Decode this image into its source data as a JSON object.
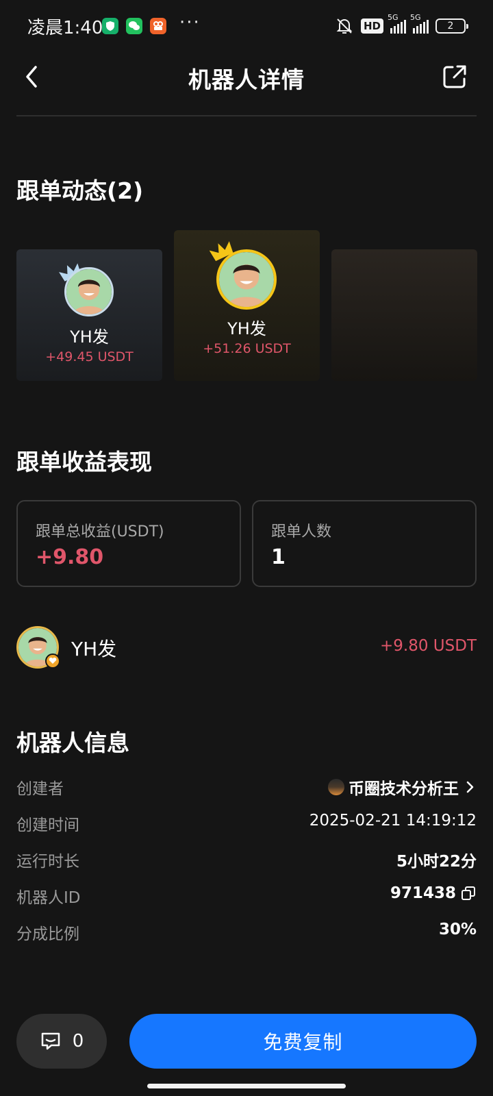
{
  "status_bar": {
    "time": "凌晨1:40",
    "dots": "···",
    "hd": "HD",
    "sim1": "5G",
    "sim2": "5G",
    "battery": "2"
  },
  "nav": {
    "title": "机器人详情"
  },
  "follow_section": {
    "title": "跟单动态(2)",
    "cards": [
      {
        "name": "YH发",
        "profit": "+49.45 USDT"
      },
      {
        "name": "YH发",
        "profit": "+51.26 USDT"
      }
    ]
  },
  "performance": {
    "title": "跟单收益表现",
    "total_label": "跟单总收益(USDT)",
    "total_value": "+9.80",
    "count_label": "跟单人数",
    "count_value": "1",
    "follower": {
      "name": "YH发",
      "profit": "+9.80 USDT"
    }
  },
  "info": {
    "title": "机器人信息",
    "creator_label": "创建者",
    "creator_value": "币圈技术分析王",
    "created_label": "创建时间",
    "created_value": "2025-02-21 14:19:12",
    "runtime_label": "运行时长",
    "runtime_value": "5小时22分",
    "id_label": "机器人ID",
    "id_value": "971438",
    "share_label": "分成比例",
    "share_value": "30%"
  },
  "bottom": {
    "comment_count": "0",
    "copy_label": "免费复制"
  },
  "colors": {
    "accent": "#1677ff",
    "profit": "#e0566a",
    "gold": "#f5c518",
    "background": "#151515"
  },
  "icons": [
    "back-arrow-icon",
    "share-icon",
    "crown-icon",
    "copy-icon",
    "chevron-right-icon",
    "comment-icon"
  ]
}
